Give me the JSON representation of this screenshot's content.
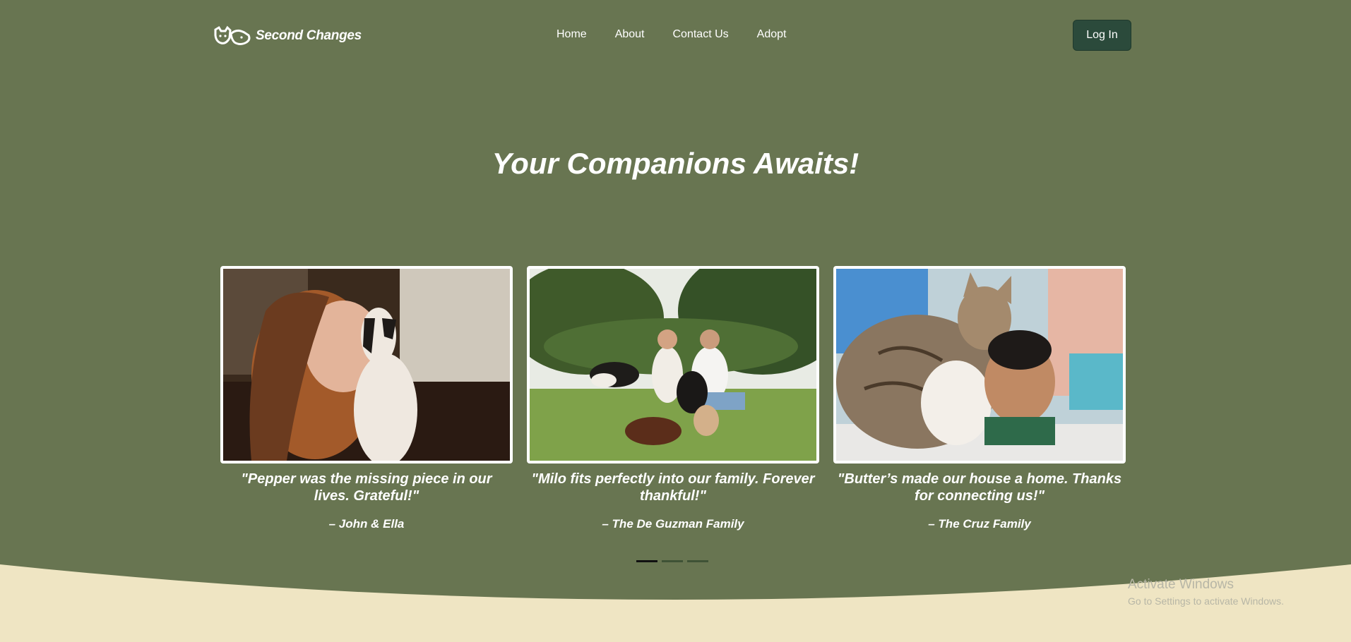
{
  "brand": {
    "name": "Second Changes"
  },
  "nav": {
    "links": [
      "Home",
      "About",
      "Contact Us",
      "Adopt"
    ],
    "login_label": "Log In"
  },
  "hero": {
    "title": "Your Companions Awaits!"
  },
  "testimonials": [
    {
      "quote": "\"Pepper was the missing piece in our lives. Grateful!\"",
      "author": "– John & Ella",
      "photo": "woman-kissing-dog-photo"
    },
    {
      "quote": "\"Milo fits perfectly into our family. Forever thankful!\"",
      "author": "– The De Guzman Family",
      "photo": "couple-with-dogs-photo"
    },
    {
      "quote": "\"Butter’s made our house a home. Thanks for connecting us!\"",
      "author": "– The Cruz Family",
      "photo": "boy-with-cat-photo"
    }
  ],
  "carousel": {
    "total": 3,
    "active": 1
  },
  "watermark": {
    "title": "Activate Windows",
    "subtitle": "Go to Settings to activate Windows."
  },
  "colors": {
    "hero_green": "#687551",
    "cream": "#efe5c3",
    "button": "#2b4a3b"
  }
}
